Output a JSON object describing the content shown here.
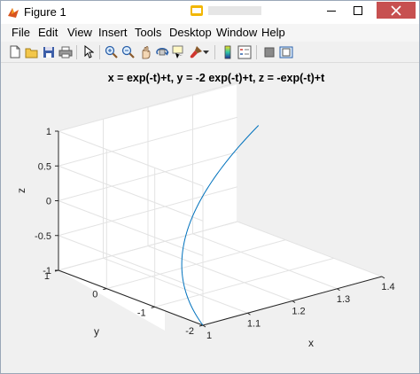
{
  "window": {
    "title": "Figure 1"
  },
  "menu": [
    "File",
    "Edit",
    "View",
    "Insert",
    "Tools",
    "Desktop",
    "Window",
    "Help"
  ],
  "toolbar": {
    "buttons": [
      "new-figure-icon",
      "open-file-icon",
      "save-icon",
      "print-icon",
      "edit-plot-arrow-icon",
      "zoom-in-icon",
      "zoom-out-icon",
      "pan-icon",
      "rotate-3d-icon",
      "data-cursor-icon",
      "brush-icon",
      "colorbar-icon",
      "legend-icon",
      "hide-plot-tools-icon",
      "show-plot-tools-icon"
    ]
  },
  "chart_data": {
    "type": "line",
    "title": "x = exp(-t)+t, y = -2 exp(-t)+t, z = -exp(-t)+t",
    "xlabel": "x",
    "ylabel": "y",
    "zlabel": "z",
    "xlim": [
      1,
      1.4
    ],
    "ylim": [
      -2,
      1
    ],
    "zlim": [
      -1,
      1
    ],
    "x_ticks": [
      "1",
      "1.1",
      "1.2",
      "1.3",
      "1.4"
    ],
    "y_ticks": [
      "-2",
      "-1",
      "0",
      "1"
    ],
    "z_ticks": [
      "-1",
      "-0.5",
      "0",
      "0.5",
      "1"
    ],
    "grid": true,
    "series": [
      {
        "color": "#0072bd",
        "parametric": {
          "x": "exp(-t)+t",
          "y": "-2*exp(-t)+t",
          "z": "-exp(-t)+t",
          "t_range": [
            0,
            1
          ]
        }
      }
    ]
  }
}
